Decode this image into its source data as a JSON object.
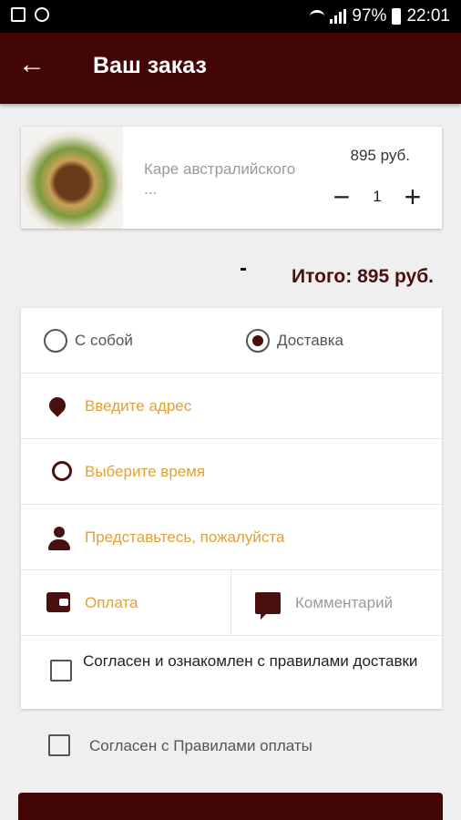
{
  "statusbar": {
    "battery": "97%",
    "time": "22:01"
  },
  "appbar": {
    "back_icon": "arrow-left-icon",
    "title": "Ваш заказ"
  },
  "cart": {
    "item": {
      "name": "Каре австралийского ...",
      "price": "895 руб.",
      "quantity": "1",
      "decrement": "−",
      "increment": "+"
    },
    "total": "Итого: 895 руб."
  },
  "form": {
    "delivery_options": [
      {
        "label": "С собой",
        "selected": false
      },
      {
        "label": "Доставка",
        "selected": true
      }
    ],
    "address_placeholder": "Введите адрес",
    "time_placeholder": "Выберите время",
    "name_placeholder": "Представьтесь, пожалуйста",
    "payment_label": "Оплата",
    "comment_label": "Комментарий",
    "agree_delivery": "Согласен и ознакомлен с правилами доставки",
    "agree_payment": "Согласен с Правилами оплаты"
  },
  "colors": {
    "brand": "#430606",
    "accent_text": "#e1a13a",
    "icon": "#4a1010"
  }
}
